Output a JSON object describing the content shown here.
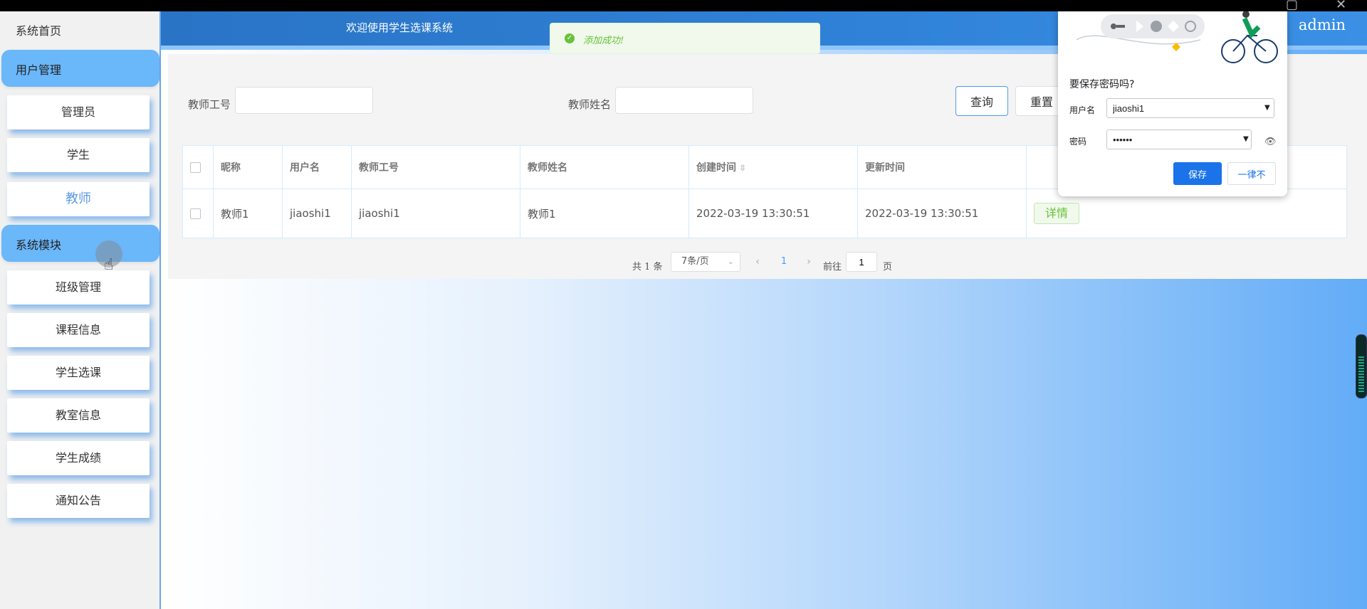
{
  "sidebar": {
    "home": "系统首页",
    "groups": [
      {
        "label": "用户管理",
        "items": [
          "管理员",
          "学生",
          "教师"
        ]
      },
      {
        "label": "系统模块",
        "items": [
          "班级管理",
          "课程信息",
          "学生选课",
          "教室信息",
          "学生成绩",
          "通知公告"
        ]
      }
    ],
    "active_item": "教师"
  },
  "header": {
    "title": "欢迎使用学生选课系统",
    "user": "admin"
  },
  "toast": {
    "message": "添加成功!",
    "type": "success",
    "color": "#67c23a"
  },
  "search": {
    "teacher_id_label": "教师工号",
    "teacher_id_value": "",
    "teacher_name_label": "教师姓名",
    "teacher_name_value": "",
    "query_label": "查询",
    "reset_label": "重置"
  },
  "table": {
    "columns": [
      "昵称",
      "用户名",
      "教师工号",
      "教师姓名",
      "创建时间",
      "更新时间"
    ],
    "rows": [
      {
        "nickname": "教师1",
        "username": "jiaoshi1",
        "teacher_id": "jiaoshi1",
        "teacher_name": "教师1",
        "created": "2022-03-19 13:30:51",
        "updated": "2022-03-19 13:30:51",
        "action": "详情"
      }
    ]
  },
  "pagination": {
    "total": "共 1 条",
    "page_size": "7条/页",
    "current_page": "1",
    "goto_label": "前往",
    "goto_value": "1",
    "page_suffix": "页"
  },
  "password_popup": {
    "title": "要保存密码吗?",
    "username_label": "用户名",
    "username_value": "jiaoshi1",
    "password_label": "密码",
    "password_value": "••••••",
    "save_label": "保存",
    "never_label": "一律不"
  },
  "colors": {
    "header_bg": "#2f82d8",
    "menu_group_bg": "#6ab7fa",
    "active_item": "#5e9be6",
    "primary_button": "#1a73e8"
  }
}
